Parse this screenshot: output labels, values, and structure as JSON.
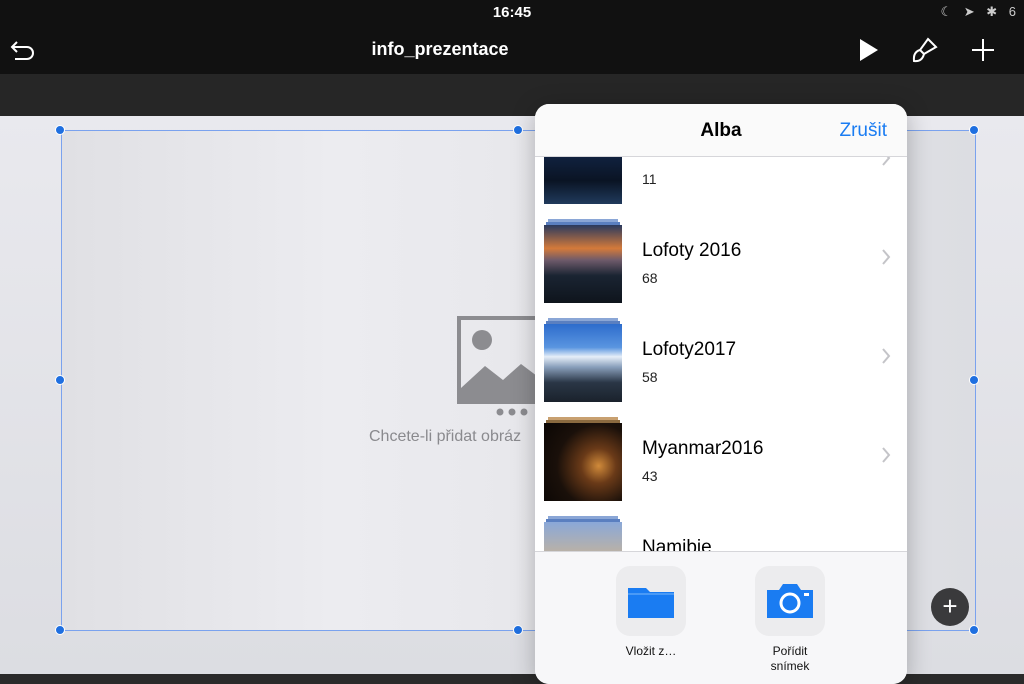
{
  "status": {
    "time": "16:45",
    "indicators": "☾ ➤ ✱ 6"
  },
  "toolbar": {
    "title": "info_prezentace",
    "icons": [
      "undo-icon",
      "play-icon",
      "brush-icon",
      "plus-icon"
    ]
  },
  "slide": {
    "placeholder_text": "Chcete-li přidat obráz"
  },
  "popover": {
    "title": "Alba",
    "cancel_label": "Zrušit",
    "albums": [
      {
        "name": "",
        "count": "11"
      },
      {
        "name": "Lofoty 2016",
        "count": "68"
      },
      {
        "name": "Lofoty2017",
        "count": "58"
      },
      {
        "name": "Myanmar2016",
        "count": "43"
      },
      {
        "name": "Namibie",
        "count": ""
      }
    ],
    "actions": [
      {
        "label": "Vložit z…",
        "icon": "folder-icon"
      },
      {
        "label": "Pořídit snímek",
        "icon": "camera-icon"
      }
    ]
  },
  "colors": {
    "accent": "#1a7cf2",
    "handle": "#1f6fe0",
    "toolbar": "#111111"
  }
}
